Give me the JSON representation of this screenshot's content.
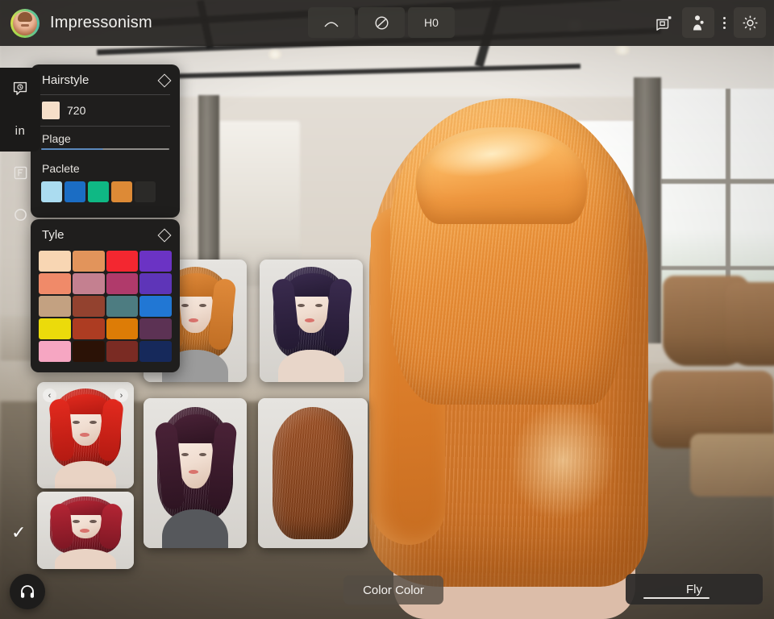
{
  "header": {
    "title": "Impressonism",
    "avatar_name": "user-avatar",
    "center_tools": [
      {
        "name": "arc-tool-button",
        "glyph": "⌒",
        "label": ""
      },
      {
        "name": "circle-slash-tool-button",
        "glyph": "⊘",
        "label": ""
      },
      {
        "name": "ho-tool-button",
        "glyph": "",
        "label": "H0"
      }
    ],
    "right_icons": [
      {
        "name": "camera-icon",
        "label": "camera"
      },
      {
        "name": "person-icon",
        "label": "person"
      },
      {
        "name": "more-options-icon",
        "label": "more"
      },
      {
        "name": "gear-icon",
        "label": "settings"
      }
    ]
  },
  "rail": {
    "items": [
      {
        "name": "sidebar-item-history",
        "glyph": "",
        "label": "history"
      },
      {
        "name": "sidebar-item-in",
        "glyph": "in",
        "label": "in"
      },
      {
        "name": "sidebar-item-frame",
        "glyph": "",
        "label": "frame"
      },
      {
        "name": "sidebar-item-circle",
        "glyph": "○",
        "label": "circle"
      }
    ]
  },
  "panel_hairstyle": {
    "title": "Hairstyle",
    "value_swatch": "#F6DFC9",
    "value_label": "720",
    "range_label": "Plage",
    "slider_fill_pct": 48,
    "palette_label": "Paclete",
    "palette": [
      "#ABDCF0",
      "#1B6DC4",
      "#0FB884",
      "#DD8A36"
    ],
    "palette_empty_slot": "#2B2A28"
  },
  "panel_tyle": {
    "title": "Tyle",
    "colors": [
      "#F8D6B3",
      "#E2945B",
      "#F32730",
      "#6B33C4",
      "#F08A69",
      "#C48090",
      "#B03A6B",
      "#5E35B8",
      "#C3A181",
      "#93422F",
      "#4D7C81",
      "#2177D4",
      "#EBDB0B",
      "#AD3C22",
      "#DD7C06",
      "#5C3254",
      "#F6A6C2",
      "#2B1206",
      "#7A2B23",
      "#16295B"
    ]
  },
  "gallery": {
    "nav_prev": "‹",
    "nav_next": "›",
    "thumbnails": [
      {
        "name": "hairstyle-thumb-orange-bob",
        "hair": "#E08A3A",
        "hair_dark": "#C06E24",
        "top": "#9b9b9b",
        "style": "orange bob"
      },
      {
        "name": "hairstyle-thumb-purple-bob",
        "hair": "#3A2B4E",
        "hair_dark": "#241A33",
        "top": "#e8d6c9",
        "style": "dark purple bob"
      },
      {
        "name": "hairstyle-thumb-red-long",
        "hair": "#E32A1E",
        "hair_dark": "#B41A12",
        "top": "#e9d3c4",
        "style": "bright red long"
      },
      {
        "name": "hairstyle-thumb-red-wavy",
        "hair": "#B42534",
        "hair_dark": "#7E1724",
        "top": "#e9d3c4",
        "style": "deep red wavy"
      },
      {
        "name": "hairstyle-thumb-plum-ombre",
        "hair": "#4A2237",
        "hair_dark": "#2E1422",
        "top": "#56585c",
        "style": "plum ombre long"
      },
      {
        "name": "hairstyle-thumb-auburn-back",
        "hair": "#A6572A",
        "hair_dark": "#7A3C18",
        "top": "#e9e5e0",
        "style": "auburn back view"
      }
    ],
    "selected_index": 3
  },
  "bottom": {
    "fab_name": "headphones-fab",
    "color_button": "Color Color",
    "fly_button": "Fly",
    "fly_progress_pct": 48,
    "confirm_check": "✓"
  },
  "colors": {
    "panel_bg": "#1F1E1D",
    "header_bg": "#262421",
    "accent_blue": "#5B89BD",
    "text": "#ECEAE7"
  }
}
